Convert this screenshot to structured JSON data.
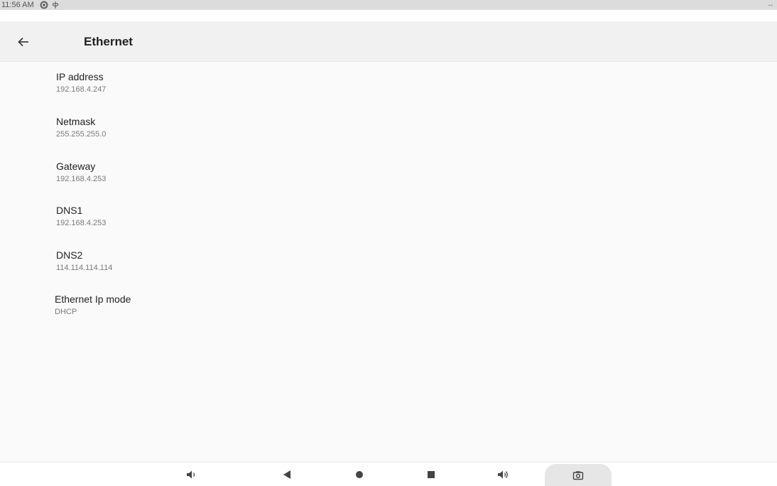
{
  "status_bar": {
    "time": "11:56 AM",
    "icons": [
      "ethernet-status-icon",
      "usb-icon"
    ],
    "right_indicator": "↔"
  },
  "app_bar": {
    "back_icon": "arrow-left-icon",
    "title": "Ethernet"
  },
  "items": [
    {
      "title": "IP address",
      "summary": "192.168.4.247"
    },
    {
      "title": "Netmask",
      "summary": "255.255.255.0"
    },
    {
      "title": "Gateway",
      "summary": "192.168.4.253"
    },
    {
      "title": "DNS1",
      "summary": "192.168.4.253"
    },
    {
      "title": "DNS2",
      "summary": "114.114.114.114"
    },
    {
      "title": "Ethernet Ip mode",
      "summary": "DHCP"
    }
  ],
  "nav_bar": {
    "buttons": [
      "volume-down-icon",
      "back-triangle-icon",
      "home-circle-icon",
      "recents-square-icon",
      "volume-up-icon",
      "camera-icon"
    ]
  },
  "colors": {
    "background": "#fafafa",
    "app_bar": "#f1f1f1",
    "title_text": "#222222",
    "summary_text": "#7a7a7a"
  }
}
